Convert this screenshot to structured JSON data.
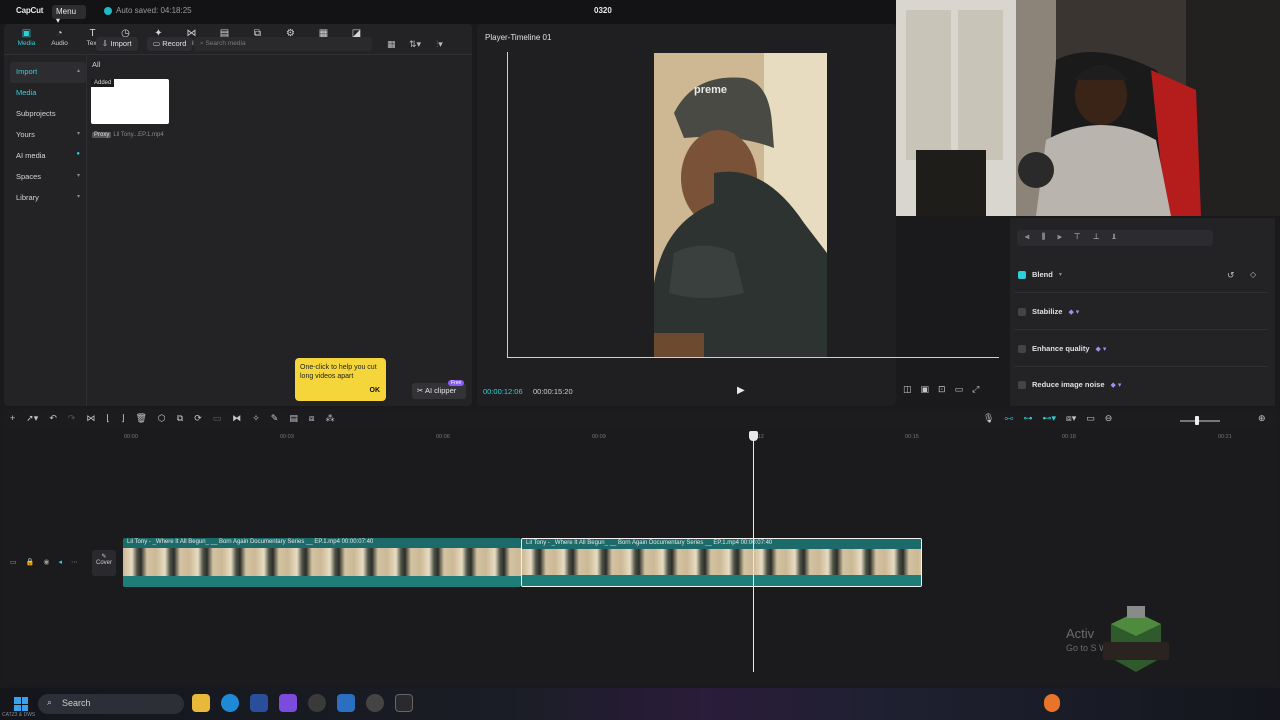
{
  "app": {
    "logo": "CapCut",
    "menu_label": "Menu",
    "autosave_text": "Auto saved: 04:18:25",
    "project_title": "0320"
  },
  "toolbar_tabs": [
    {
      "label": "Media",
      "icon": "media-icon",
      "active": true
    },
    {
      "label": "Audio",
      "icon": "audio-icon"
    },
    {
      "label": "Text",
      "icon": "text-icon"
    },
    {
      "label": "Stickers",
      "icon": "stickers-icon"
    },
    {
      "label": "Effects",
      "icon": "effects-icon"
    },
    {
      "label": "Transitions",
      "icon": "transitions-icon"
    },
    {
      "label": "Captions",
      "icon": "captions-icon"
    },
    {
      "label": "Filters",
      "icon": "filters-icon"
    },
    {
      "label": "Adjustment",
      "icon": "adjustment-icon"
    },
    {
      "label": "Templates",
      "icon": "templates-icon"
    },
    {
      "label": "AI avatar",
      "icon": "ai-avatar-icon"
    }
  ],
  "sidebar": [
    {
      "label": "Import",
      "state": "active",
      "chevron": "▴"
    },
    {
      "label": "Media",
      "state": "current",
      "chevron": ""
    },
    {
      "label": "Subprojects",
      "state": "",
      "chevron": ""
    },
    {
      "label": "Yours",
      "state": "",
      "chevron": "▾"
    },
    {
      "label": "AI media",
      "state": "",
      "chevron": "●"
    },
    {
      "label": "Spaces",
      "state": "",
      "chevron": "▾"
    },
    {
      "label": "Library",
      "state": "",
      "chevron": "▾"
    }
  ],
  "media": {
    "import_label": "Import",
    "record_label": "Record",
    "search_placeholder": "Search media",
    "filter_all": "All",
    "item_badge": "Added",
    "proxy_tag": "Proxy",
    "item_name": "Lil Tony...EP.1.mp4",
    "tooltip_text": "One-click to help you cut long videos apart",
    "tooltip_ok": "OK",
    "ai_clipper_label": "AI clipper",
    "free_badge": "Free"
  },
  "player": {
    "title": "Player-Timeline 01",
    "current_time": "00:00:12:06",
    "duration": "00:00:15:20"
  },
  "properties": {
    "rows": [
      {
        "label": "Blend",
        "checked": true,
        "pro": false
      },
      {
        "label": "Stabilize",
        "checked": false,
        "pro": true
      },
      {
        "label": "Enhance quality",
        "checked": false,
        "pro": true
      },
      {
        "label": "Reduce image noise",
        "checked": false,
        "pro": true
      }
    ]
  },
  "timeline": {
    "ruler_ticks": [
      "00:00",
      "00:03",
      "00:06",
      "00:09",
      "00:12",
      "00:15",
      "00:18",
      "00:21"
    ],
    "cover_label": "Cover",
    "clips": [
      {
        "label": "Lil Tony - _Where It All Begun_ __ Born Again Documentary Series __ EP.1.mp4   00:00:07:40",
        "selected": false
      },
      {
        "label": "Lil Tony - _Where It All Begun_ __ Born Again Documentary Series __ EP.1.mp4   00:00:07:40",
        "selected": true
      }
    ]
  },
  "watermark": {
    "line1": "Activ",
    "line2": "Go to S                              Windows."
  },
  "taskbar": {
    "search_placeholder": "Search",
    "corner_text": "CATZ3 & DWS"
  },
  "colors": {
    "accent": "#2fd1d8",
    "tooltip_bg": "#f5d63a",
    "clip_bg": "#1c6a69",
    "pro_badge": "#a58cf0"
  }
}
